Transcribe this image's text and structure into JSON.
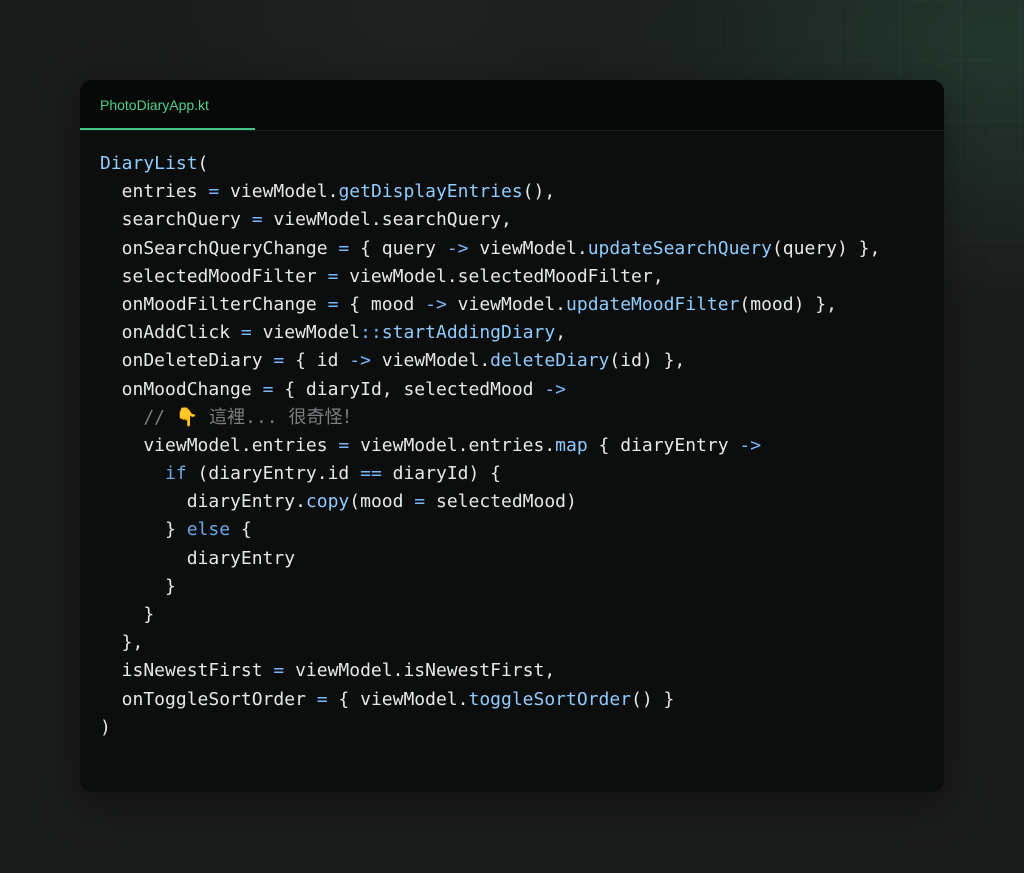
{
  "tab": {
    "filename": "PhotoDiaryApp.kt"
  },
  "colors": {
    "tab_accent": "#3ec48a",
    "operator": "#79b8ff",
    "function": "#8ecbff",
    "keyword": "#6aa9e8",
    "comment": "#7c7f81",
    "text": "#e6e8e8"
  },
  "code": {
    "l1": [
      "DiaryList",
      "("
    ],
    "l2": [
      "  entries ",
      "=",
      " viewModel.",
      "getDisplayEntries",
      "(),"
    ],
    "l3": [
      "  searchQuery ",
      "=",
      " viewModel.searchQuery,"
    ],
    "l4": [
      "  onSearchQueryChange ",
      "=",
      " { query ",
      "->",
      " viewModel.",
      "updateSearchQuery",
      "(query) },"
    ],
    "l5": [
      "  selectedMoodFilter ",
      "=",
      " viewModel.selectedMoodFilter,"
    ],
    "l6": [
      "  onMoodFilterChange ",
      "=",
      " { mood ",
      "->",
      " viewModel.",
      "updateMoodFilter",
      "(mood) },"
    ],
    "l7": [
      "  onAddClick ",
      "=",
      " viewModel",
      "::",
      "startAddingDiary",
      ","
    ],
    "l8": [
      "  onDeleteDiary ",
      "=",
      " { id ",
      "->",
      " viewModel.",
      "deleteDiary",
      "(id) },"
    ],
    "l9": [
      "  onMoodChange ",
      "=",
      " { diaryId, selectedMood ",
      "->"
    ],
    "l10": [
      "    // ",
      "👇",
      " 這裡... 很奇怪！"
    ],
    "l11": [
      "    viewModel.entries ",
      "=",
      " viewModel.entries.",
      "map",
      " { diaryEntry ",
      "->"
    ],
    "l12": [
      "      ",
      "if",
      " (diaryEntry.id ",
      "==",
      " diaryId) {"
    ],
    "l13": [
      "        diaryEntry.",
      "copy",
      "(mood ",
      "=",
      " selectedMood)"
    ],
    "l14": [
      "      } ",
      "else",
      " {"
    ],
    "l15": [
      "        diaryEntry"
    ],
    "l16": [
      "      }"
    ],
    "l17": [
      "    }"
    ],
    "l18": [
      "  },"
    ],
    "l19": [
      "  isNewestFirst ",
      "=",
      " viewModel.isNewestFirst,"
    ],
    "l20": [
      "  onToggleSortOrder ",
      "=",
      " { viewModel.",
      "toggleSortOrder",
      "() }"
    ],
    "l21": [
      ")"
    ]
  }
}
